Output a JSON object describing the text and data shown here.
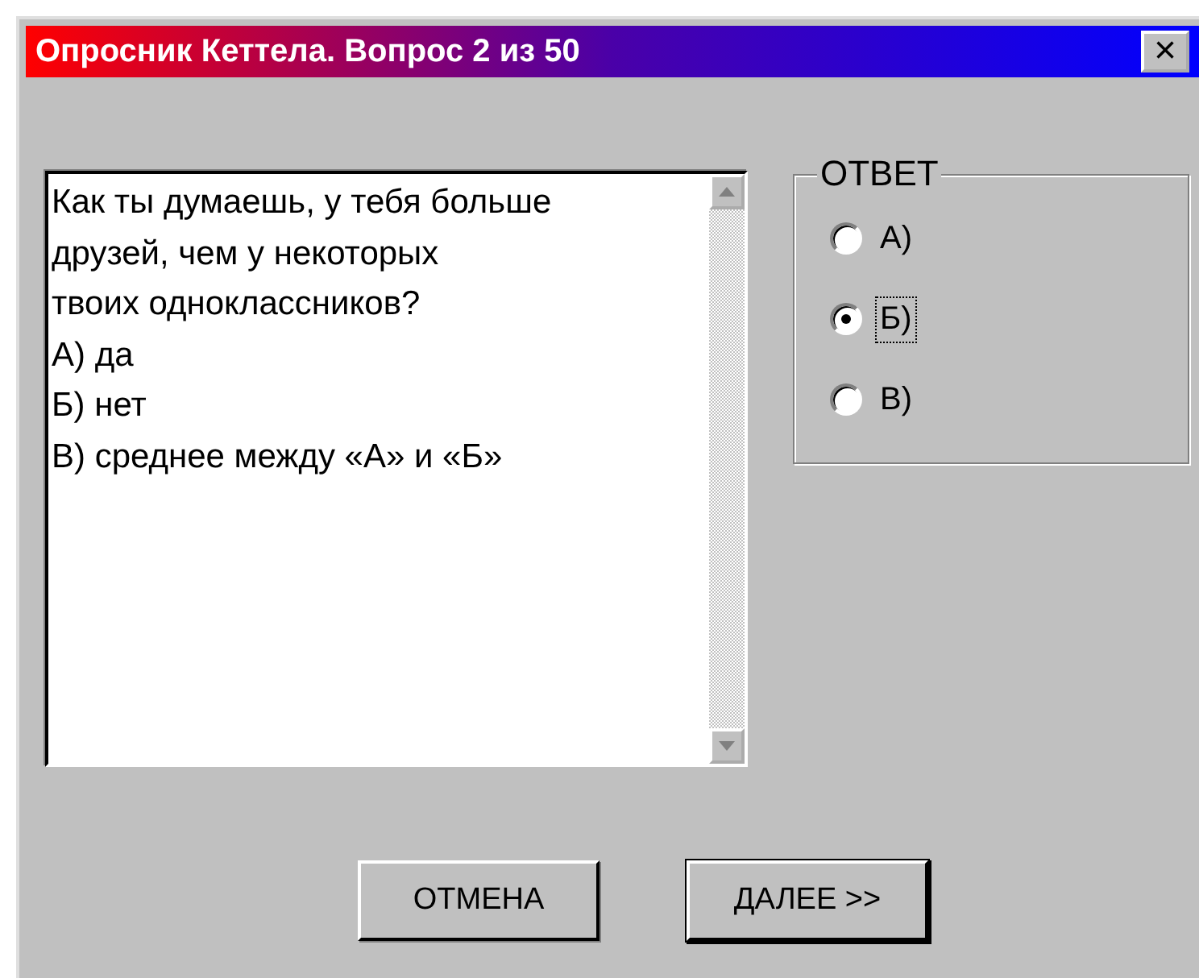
{
  "window": {
    "title": "Опросник Кеттела. Вопрос 2 из 50",
    "close": "×"
  },
  "question": {
    "lines": [
      "Как ты думаешь, у тебя больше",
      "друзей, чем у некоторых",
      "твоих одноклассников?",
      "А) да",
      "Б) нет",
      "В) среднее между «А» и «Б»"
    ]
  },
  "answer": {
    "title": "ОТВЕТ",
    "options": [
      {
        "label": "А)",
        "selected": false,
        "focused": false
      },
      {
        "label": "Б)",
        "selected": true,
        "focused": true
      },
      {
        "label": "В)",
        "selected": false,
        "focused": false
      }
    ]
  },
  "buttons": [
    {
      "label": "ОТМЕНА",
      "default": false
    },
    {
      "label": "ДАЛЕЕ >>",
      "default": true
    }
  ]
}
